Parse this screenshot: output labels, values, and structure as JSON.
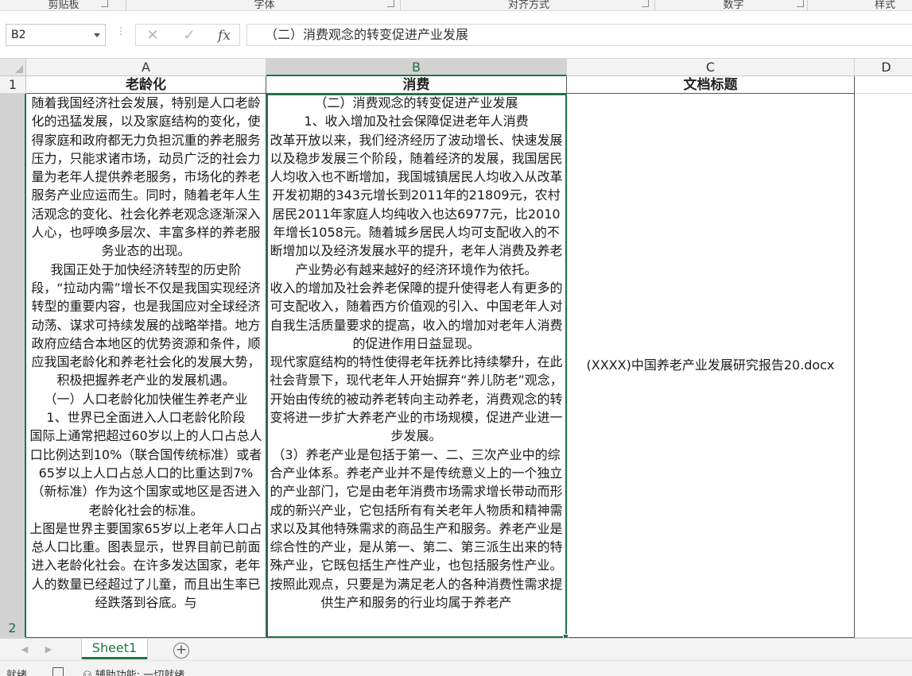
{
  "ribbon": {
    "groups": [
      {
        "label": "剪贴板"
      },
      {
        "label": "字体"
      },
      {
        "label": "对齐方式"
      },
      {
        "label": "数字"
      },
      {
        "label": "样式"
      }
    ]
  },
  "formula_bar": {
    "name_box": "B2",
    "cancel_icon": "close-icon",
    "enter_icon": "check-icon",
    "fx_label": "fx",
    "formula": "（二）消费观念的转变促进产业发展"
  },
  "columns": [
    "A",
    "B",
    "C",
    "D"
  ],
  "rows": [
    "1",
    "2"
  ],
  "cells": {
    "A1": "老龄化",
    "B1": "消费",
    "C1": "文档标题",
    "A2": [
      "随着我国经济社会发展，特别是人口老龄化的迅猛发展，以及家庭结构的变化，使得家庭和政府都无力负担沉重的养老服务压力，只能求诸市场，动员广泛的社会力量为老年人提供养老服务，市场化的养老服务产业应运而生。同时，随着老年人生活观念的变化、社会化养老观念逐渐深入人心，也呼唤多层次、丰富多样的养老服务业态的出现。",
      "我国正处于加快经济转型的历史阶段，“拉动内需”增长不仅是我国实现经济转型的重要内容，也是我国应对全球经济动荡、谋求可持续发展的战略举措。地方政府应结合本地区的优势资源和条件，顺应我国老龄化和养老社会化的发展大势，积极把握养老产业的发展机遇。",
      "（一）人口老龄化加快催生养老产业",
      "1、世界已全面进入人口老龄化阶段",
      "国际上通常把超过60岁以上的人口占总人口比例达到10%（联合国传统标准）或者65岁以上人口占总人口的比重达到7%（新标准）作为这个国家或地区是否进入老龄化社会的标准。",
      "上图是世界主要国家65岁以上老年人口占总人口比重。图表显示，世界目前已前面进入老龄化社会。在许多发达国家，老年人的数量已经超过了儿童，而且出生率已经跌落到谷底。与"
    ],
    "B2": [
      "（二）消费观念的转变促进产业发展",
      "1、收入增加及社会保障促进老年人消费",
      "改革开放以来，我们经济经历了波动增长、快速发展以及稳步发展三个阶段，随着经济的发展，我国居民人均收入也不断增加，我国城镇居民人均收入从改革开发初期的343元增长到2011年的21809元，农村居民2011年家庭人均纯收入也达6977元，比2010年增长1058元。随着城乡居民人均可支配收入的不断增加以及经济发展水平的提升，老年人消费及养老产业势必有越来越好的经济环境作为依托。",
      "收入的增加及社会养老保障的提升使得老人有更多的可支配收入，随着西方价值观的引入、中国老年人对自我生活质量要求的提高，收入的增加对老年人消费的促进作用日益显现。",
      "现代家庭结构的特性使得老年抚养比持续攀升，在此社会背景下，现代老年人开始摒弃“养儿防老”观念，开始由传统的被动养老转向主动养老，消费观念的转变将进一步扩大养老产业的市场规模，促进产业进一步发展。",
      "（3）养老产业是包括于第一、二、三次产业中的综合产业体系。养老产业并不是传统意义上的一个独立的产业部门，它是由老年消费市场需求增长带动而形成的新兴产业，它包括所有有关老年人物质和精神需求以及其他特殊需求的商品生产和服务。养老产业是综合性的产业，是从第一、第二、第三派生出来的特殊产业，它既包括生产性产业，也包括服务性产业。按照此观点，只要是为满足老人的各种消费性需求提供生产和服务的行业均属于养老产"
    ],
    "C2": "(XXXX)中国养老产业发展研究报告20.docx"
  },
  "sheet_tabs": [
    {
      "label": "Sheet1",
      "active": true
    }
  ],
  "add_sheet_label": "+",
  "status_bar": {
    "ready": "就绪",
    "accessibility": "辅助功能: 一切就绪"
  },
  "colors": {
    "accent": "#217346",
    "header_bg": "#f3f3f3",
    "selected_header_bg": "#d2d2d2",
    "gridline": "#d4d4d4"
  }
}
